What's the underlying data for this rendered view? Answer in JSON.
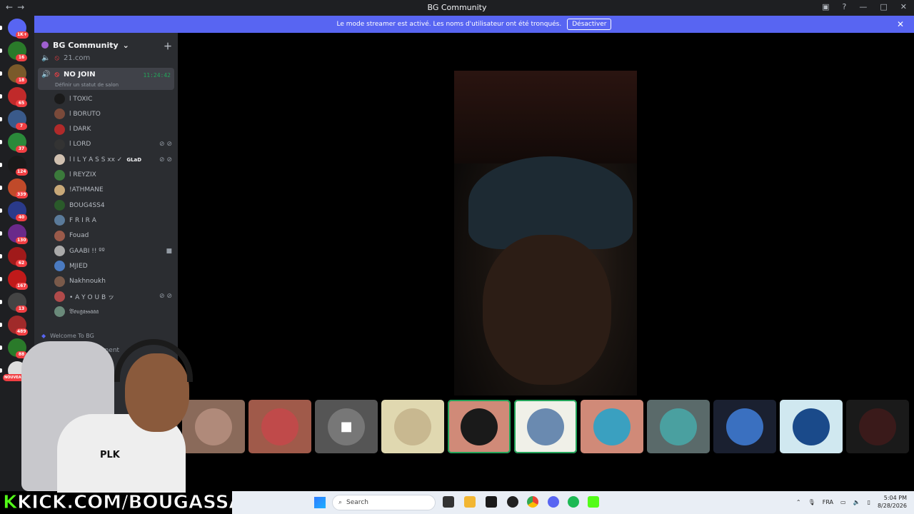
{
  "window": {
    "title": "BG Community",
    "nav_back": "←",
    "nav_forward": "→"
  },
  "banner": {
    "message": "Le mode streamer est activé. Les noms d'utilisateur ont été tronqués.",
    "button": "Désactiver"
  },
  "server_rail": {
    "badges": [
      "1K+",
      "16",
      "18",
      "65",
      "7",
      "37",
      "124",
      "339",
      "40",
      "130",
      "62",
      "167",
      "13",
      "489",
      "88",
      "NOUVEAU"
    ]
  },
  "sidebar": {
    "server_name": "BG Community",
    "channels": [
      {
        "name": "21.com"
      },
      {
        "name": "NO JOIN",
        "timer": "11:24:42",
        "status_prompt": "Définir un statut de salon"
      }
    ],
    "members": [
      {
        "name": "l TOXIC",
        "color": "#1a1a1a"
      },
      {
        "name": "l BORUTO",
        "color": "#7a4a3a"
      },
      {
        "name": "l DARK",
        "color": "#b02a2a"
      },
      {
        "name": "l LORD",
        "color": "#333333"
      },
      {
        "name": "l I L Y A S S xx ✓",
        "color": "#d0c0b0",
        "tag": "GLaD"
      },
      {
        "name": "l REYZIX",
        "color": "#3b7a3b"
      },
      {
        "name": "!ATHMANE",
        "color": "#c8a878"
      },
      {
        "name": "BOUG4SS4",
        "color": "#2a5a2a"
      },
      {
        "name": "F R I R A",
        "color": "#5a7a9a"
      },
      {
        "name": "Fouad",
        "color": "#9a5a4a"
      },
      {
        "name": "GAABI !! ºº",
        "color": "#aaaaaa"
      },
      {
        "name": "MJIED",
        "color": "#4a7ac0"
      },
      {
        "name": "Nakhnoukh",
        "color": "#7a5a4a"
      },
      {
        "name": "• A Y O U B ッ",
        "color": "#b04a4a"
      },
      {
        "name": "𝔅𝔬𝔲𝔤𝔞𝔰𝔰𝔞𝔞𝔞",
        "color": "#6a8a7a"
      }
    ],
    "category": "Welcome To BG",
    "partial_channel": "ement",
    "hash_symbol": "#"
  },
  "tiles": [
    {
      "bg": "#8a6a5a",
      "avatar": "#b08a7a"
    },
    {
      "bg": "#a05a4a",
      "avatar": "#c04a4a"
    },
    {
      "bg": "#555555",
      "avatar": "#777777",
      "camera": true
    },
    {
      "bg": "#e0d8b0",
      "avatar": "#c8b890"
    },
    {
      "bg": "#d08a78",
      "avatar": "#1a1a1a",
      "selected": true
    },
    {
      "bg": "#f0f0e8",
      "avatar": "#6a8ab0",
      "selected": true
    },
    {
      "bg": "#d08a78",
      "avatar": "#3aa0c0"
    },
    {
      "bg": "#5a6a6a",
      "avatar": "#4aa0a0"
    },
    {
      "bg": "#1a2030",
      "avatar": "#3a70c0"
    },
    {
      "bg": "#d0e8f0",
      "avatar": "#1a4a8a"
    },
    {
      "bg": "#1a1a1a",
      "avatar": "#3a1a1a"
    }
  ],
  "overlay": {
    "kick_prefix": "K",
    "kick_text": "KICK.COM/BOUGASSAA",
    "shirt_print": "PLK"
  },
  "taskbar": {
    "search_placeholder": "Search",
    "language": "FRA",
    "time": "5:04 PM",
    "date": "8/28/2026"
  }
}
